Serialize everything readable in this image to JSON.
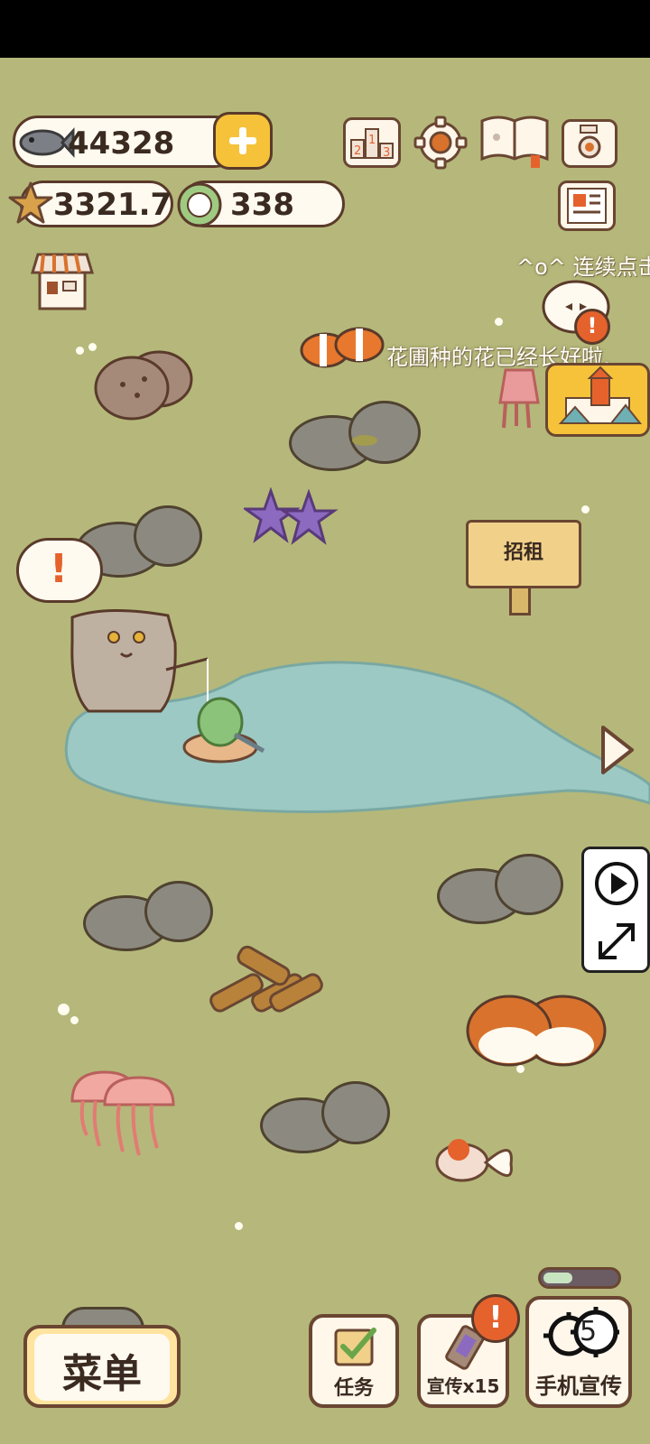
{
  "hud": {
    "fish_count": "44328",
    "star_value": "3321.7",
    "token_count": "338",
    "rank_icon_digits": "213"
  },
  "ticker": {
    "line1": "^o^ 连续点击",
    "line2": "花圃种的花已经长好啦,"
  },
  "sign": {
    "label": "招租"
  },
  "bubble": {
    "mark": "!"
  },
  "bottom": {
    "menu_label": "菜单",
    "task_label": "任务",
    "promo_label": "宣传x15",
    "phone_promo_label": "手机宣传",
    "phone_promo_count": "5"
  },
  "colors": {
    "grass": "#b5b87a",
    "pond": "#9cc9c4",
    "plus_button": "#f5c23a",
    "alert": "#e5622d",
    "outline": "#5a3a2a"
  },
  "icons": [
    "fish-icon",
    "plus-icon",
    "star-icon",
    "token-icon",
    "ranking-icon",
    "settings-icon",
    "book-icon",
    "camera-icon",
    "news-icon",
    "shop-icon",
    "play-icon",
    "expand-icon",
    "arrow-right-icon",
    "alert-icon"
  ]
}
